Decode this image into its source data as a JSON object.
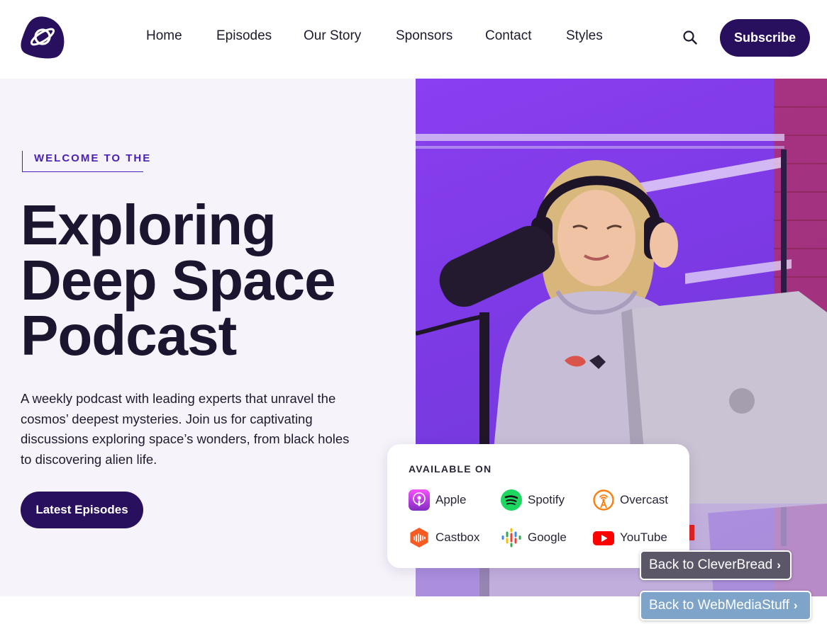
{
  "nav": {
    "items": [
      {
        "label": "Home"
      },
      {
        "label": "Episodes"
      },
      {
        "label": "Our Story"
      },
      {
        "label": "Sponsors"
      },
      {
        "label": "Contact"
      },
      {
        "label": "Styles"
      }
    ],
    "subscribe_label": "Subscribe"
  },
  "hero": {
    "eyebrow": "WELCOME TO THE",
    "title_lines": [
      "Exploring",
      "Deep Space",
      "Podcast"
    ],
    "description": "A weekly podcast with leading experts that unravel the cosmos’ deepest mysteries. Join us for captivating discussions exploring space’s wonders, from black holes to discovering alien life.",
    "cta_label": "Latest Episodes"
  },
  "available": {
    "title": "AVAILABLE ON",
    "platforms": [
      {
        "label": "Apple",
        "icon": "apple-podcasts-icon"
      },
      {
        "label": "Spotify",
        "icon": "spotify-icon"
      },
      {
        "label": "Overcast",
        "icon": "overcast-icon"
      },
      {
        "label": "Castbox",
        "icon": "castbox-icon"
      },
      {
        "label": "Google",
        "icon": "google-podcasts-icon"
      },
      {
        "label": "YouTube",
        "icon": "youtube-icon"
      }
    ]
  },
  "back_links": [
    {
      "label": "Back to CleverBread"
    },
    {
      "label": "Back to WebMediaStuff"
    }
  ],
  "colors": {
    "brand": "#28105f",
    "accent": "#4a1fb8",
    "hero_bg": "#f6f3fa"
  }
}
